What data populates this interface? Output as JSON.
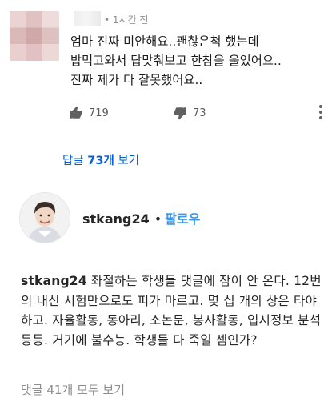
{
  "reply": {
    "time": "• 1시간 전",
    "text": "엄마 진짜 미안해요..괜찮은척 했는데\n밥먹고와서 답맞춰보고 한참을 울었어요..\n진짜 제가 다 잘못했어요..",
    "likes": "719",
    "dislikes": "73"
  },
  "replies_link": {
    "prefix": "답글 ",
    "count": "73개",
    "suffix": " 보기"
  },
  "post": {
    "username": "stkang24",
    "separator": "•",
    "follow_label": "팔로우",
    "caption_username": "stkang24",
    "caption": " 좌절하는 학생들 댓글에 잠이 안 온다. 12번의 내신 시험만으로도 피가 마르고. 몇 십 개의 상은 타야 하고. 자율활동, 동아리, 소논문, 봉사활동, 입시정보 분석 등등. 거기에 불수능. 학생들 다 죽일 셈인가?",
    "view_all_comments": "댓글 41개 모두 보기"
  },
  "colors": {
    "link_blue": "#065fd4",
    "follow_blue": "#3897f0",
    "muted_gray": "#8e8e8e"
  }
}
